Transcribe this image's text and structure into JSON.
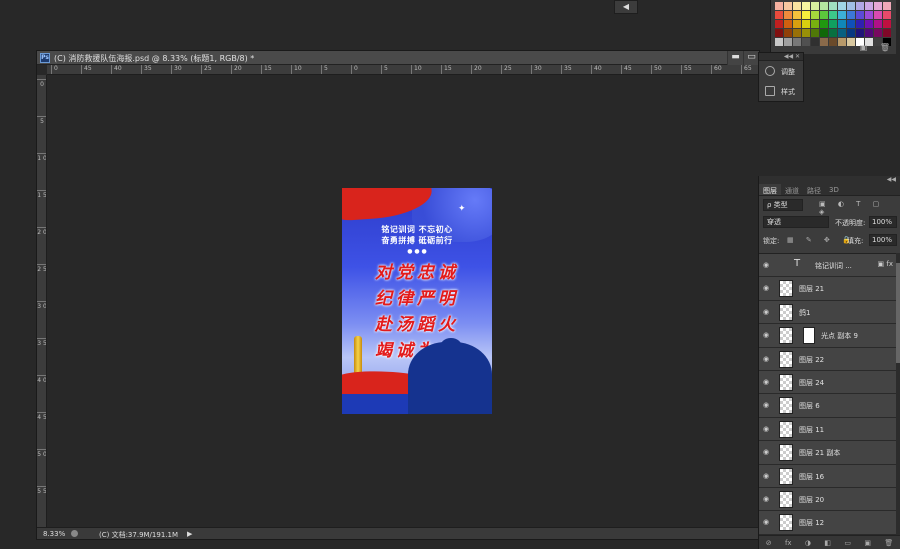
{
  "top_toggle_label": "◀",
  "document": {
    "title": "(C) 消防救援队伍海报.psd @ 8.33% (标题1, RGB/8) *",
    "ps_icon": "Ps",
    "win_minimize": "▬",
    "win_maximize": "▭",
    "zoom": "8.33%",
    "doc_size": "(C) 文档:37.9M/191.1M",
    "status_arrow": "▶"
  },
  "ruler": {
    "h_labels": [
      "0",
      "45",
      "40",
      "35",
      "30",
      "25",
      "20",
      "15",
      "10",
      "5",
      "0",
      "5",
      "10",
      "15",
      "20",
      "25",
      "30",
      "35",
      "40",
      "45",
      "50",
      "55",
      "60",
      "65"
    ],
    "v_labels": [
      "0",
      "5",
      "1 0",
      "1 5",
      "2 0",
      "2 5",
      "3 0",
      "3 5",
      "4 0",
      "4 5",
      "5 0",
      "5 5"
    ]
  },
  "poster": {
    "slogan_line1": "铭记训词  不忘初心",
    "slogan_line2": "奋勇拼搏  砥砺前行",
    "dots": "● ● ●",
    "line1": "对党忠诚",
    "line2": "纪律严明",
    "line3": "赴汤蹈火",
    "line4": "竭诚为民",
    "colors": {
      "red": "#d9241c",
      "blue": "#2c3bc9",
      "text_red": "#e31b1b"
    }
  },
  "mini_panel": {
    "collapse": "◀◀ ✕",
    "items": [
      {
        "label": "调整",
        "icon": "adjust-icon"
      },
      {
        "label": "样式",
        "icon": "styles-icon"
      }
    ]
  },
  "layers_panel": {
    "collapse": "◀◀",
    "tabs": [
      "图层",
      "通道",
      "路径",
      "3D"
    ],
    "filter_label": "ρ 类型",
    "filter_icons": "▣ ◐ T ▢ ◈",
    "blend_mode": "穿透",
    "opacity_label": "不透明度:",
    "opacity_value": "100%",
    "lock_label": "锁定:",
    "lock_icons": "▦ ✎ ✥ 🔒",
    "fill_label": "填充:",
    "fill_value": "100%",
    "layers": [
      {
        "name": "铭记训词 ...",
        "type": "text",
        "fx": "▣ fx"
      },
      {
        "name": "图层 21",
        "type": "pixel",
        "fx": ""
      },
      {
        "name": "鸽1",
        "type": "pixel",
        "fx": ""
      },
      {
        "name": "光点 副本 9",
        "type": "masked",
        "fx": ""
      },
      {
        "name": "图层 22",
        "type": "pixel",
        "fx": ""
      },
      {
        "name": "图层 24",
        "type": "pixel",
        "fx": ""
      },
      {
        "name": "图层 6",
        "type": "pixel",
        "fx": ""
      },
      {
        "name": "图层 11",
        "type": "pixel",
        "fx": ""
      },
      {
        "name": "图层 21 副本",
        "type": "pixel",
        "fx": ""
      },
      {
        "name": "图层 16",
        "type": "pixel",
        "fx": ""
      },
      {
        "name": "图层 20",
        "type": "pixel",
        "fx": ""
      },
      {
        "name": "图层 12",
        "type": "pixel",
        "fx": ""
      }
    ],
    "footer_icons": [
      "⊘",
      "fx",
      "◑",
      "◧",
      "▭",
      "▣",
      "🗑"
    ]
  },
  "swatches": {
    "footer_icons": [
      "▣",
      "🗑"
    ],
    "colors": [
      "#f5b0a0",
      "#f7c7a0",
      "#f8e2a0",
      "#f8f5a0",
      "#d9f0a0",
      "#b5e6a0",
      "#a0e0c0",
      "#a0d6e6",
      "#a0bfe6",
      "#b0a8e6",
      "#cca8e6",
      "#e6a8d6",
      "#f0a8b8",
      "#e84a3c",
      "#f08a3c",
      "#f5c13c",
      "#f5ee3c",
      "#a6d83c",
      "#5cc83c",
      "#3cc88a",
      "#3cb0d8",
      "#3c78d8",
      "#5c4ad8",
      "#9a4ad8",
      "#d84ab0",
      "#e84a6a",
      "#c02020",
      "#d06010",
      "#d8a010",
      "#d8d010",
      "#78b010",
      "#209810",
      "#10a060",
      "#1088b8",
      "#1050b8",
      "#3020b0",
      "#7010b0",
      "#b01088",
      "#c01040",
      "#801010",
      "#904008",
      "#987008",
      "#989008",
      "#507808",
      "#106808",
      "#087040",
      "#086080",
      "#083880",
      "#201478",
      "#500878",
      "#780860",
      "#800828",
      "#c8c8c8",
      "#a0a0a0",
      "#787878",
      "#505050",
      "#303030",
      "#8a6a4a",
      "#6a4a2a",
      "#b89a6a",
      "#d8c8a0",
      "#ffffff",
      "#e0e0e0",
      "#404040",
      "#000000"
    ]
  }
}
